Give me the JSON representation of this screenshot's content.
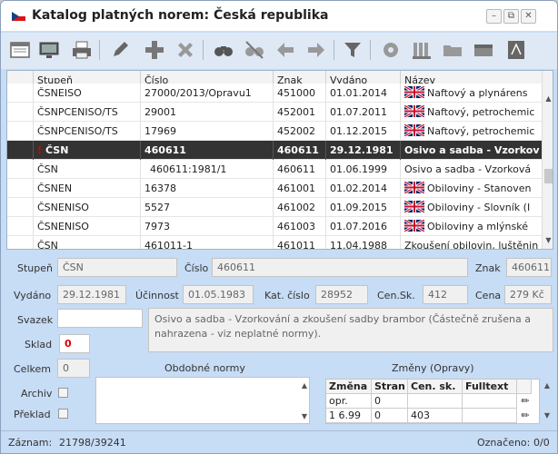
{
  "window": {
    "title": "Katalog platných norem: Česká republika",
    "controls": [
      "minimize",
      "restore",
      "close"
    ]
  },
  "toolbar": {
    "icons": [
      "window-icon",
      "monitor-icon",
      "print-icon",
      "edit-icon",
      "add-icon",
      "delete-icon",
      "search-icon",
      "search-clear-icon",
      "back-icon",
      "forward-icon",
      "filter-icon",
      "settings-icon",
      "library-icon",
      "folder-icon",
      "archive-icon",
      "pdf-icon"
    ]
  },
  "grid": {
    "columns": [
      "Stupeň",
      "Číslo",
      "Znak",
      "Vydáno",
      "Název"
    ],
    "rows": [
      {
        "stupen": "ČSNEISO",
        "cislo": "27000/2013/Opravu1",
        "znak": "451000",
        "vydano": "01.01.2014",
        "flag": true,
        "nazev": "Naftový a plynárens"
      },
      {
        "stupen": "ČSNPCENISO/TS",
        "cislo": "29001",
        "znak": "452001",
        "vydano": "01.07.2011",
        "flag": true,
        "nazev": "Naftový, petrochemic"
      },
      {
        "stupen": "ČSNPCENISO/TS",
        "cislo": "17969",
        "znak": "452002",
        "vydano": "01.12.2015",
        "flag": true,
        "nazev": "Naftový, petrochemic"
      },
      {
        "stupen": "ČSN",
        "cislo": "460611",
        "znak": "460611",
        "vydano": "29.12.1981",
        "flag": false,
        "nazev": "Osivo a sadba - Vzorkov",
        "selected": true,
        "warning": "!"
      },
      {
        "stupen": "ČSN",
        "cislo": "460611:1981/1",
        "znak": "460611",
        "vydano": "01.06.1999",
        "flag": false,
        "nazev": "Osivo a sadba - Vzorková"
      },
      {
        "stupen": "ČSNEN",
        "cislo": "16378",
        "znak": "461001",
        "vydano": "01.02.2014",
        "flag": true,
        "nazev": "Obiloviny - Stanoven"
      },
      {
        "stupen": "ČSNENISO",
        "cislo": "5527",
        "znak": "461002",
        "vydano": "01.09.2015",
        "flag": true,
        "nazev": "Obiloviny - Slovník (I"
      },
      {
        "stupen": "ČSNENISO",
        "cislo": "7973",
        "znak": "461003",
        "vydano": "01.07.2016",
        "flag": true,
        "nazev": "Obiloviny a mlýnské"
      },
      {
        "stupen": "ČSN",
        "cislo": "461011-1",
        "znak": "461011",
        "vydano": "11.04.1988",
        "flag": false,
        "nazev": "Zkoušení obilovin, luštěnin"
      }
    ]
  },
  "detail": {
    "stupen_label": "Stupeň",
    "stupen": "ČSN",
    "cislo_label": "Číslo",
    "cislo": "460611",
    "znak_label": "Znak",
    "znak": "460611",
    "vydano_label": "Vydáno",
    "vydano": "29.12.1981",
    "ucinnost_label": "Účinnost",
    "ucinnost": "01.05.1983",
    "katcislo_label": "Kat. číslo",
    "katcislo": "28952",
    "censk_label": "Cen.Sk.",
    "censk": "412",
    "cena_label": "Cena",
    "cena": "279 Kč",
    "svazek_label": "Svazek",
    "svazek": "",
    "sklad_label": "Sklad",
    "sklad": "0",
    "celkem_label": "Celkem",
    "celkem": "0",
    "description": "Osivo a sadba - Vzorkování a zkoušení sadby brambor (Částečně zrušena a nahrazena - viz neplatné normy).",
    "obdobne_label": "Obdobné normy",
    "zmeny_label": "Změny (Opravy)",
    "archiv_label": "Archiv",
    "preklad_label": "Překlad"
  },
  "changes": {
    "columns": [
      "Změna",
      "Stran",
      "Cen. sk.",
      "Fulltext"
    ],
    "rows": [
      {
        "zmena": "opr.",
        "stran": "0",
        "censk": "",
        "fulltext": ""
      },
      {
        "zmena": "1 6.99",
        "stran": "0",
        "censk": "403",
        "fulltext": ""
      }
    ]
  },
  "status": {
    "zaznam_label": "Záznam:",
    "zaznam": "21798/39241",
    "oznaceno_label": "Označeno:",
    "oznaceno": "0/0"
  },
  "colors": {
    "selected_row": "#333333",
    "window_bg": "#c7dcf5",
    "sklad_value": "#e00000"
  }
}
